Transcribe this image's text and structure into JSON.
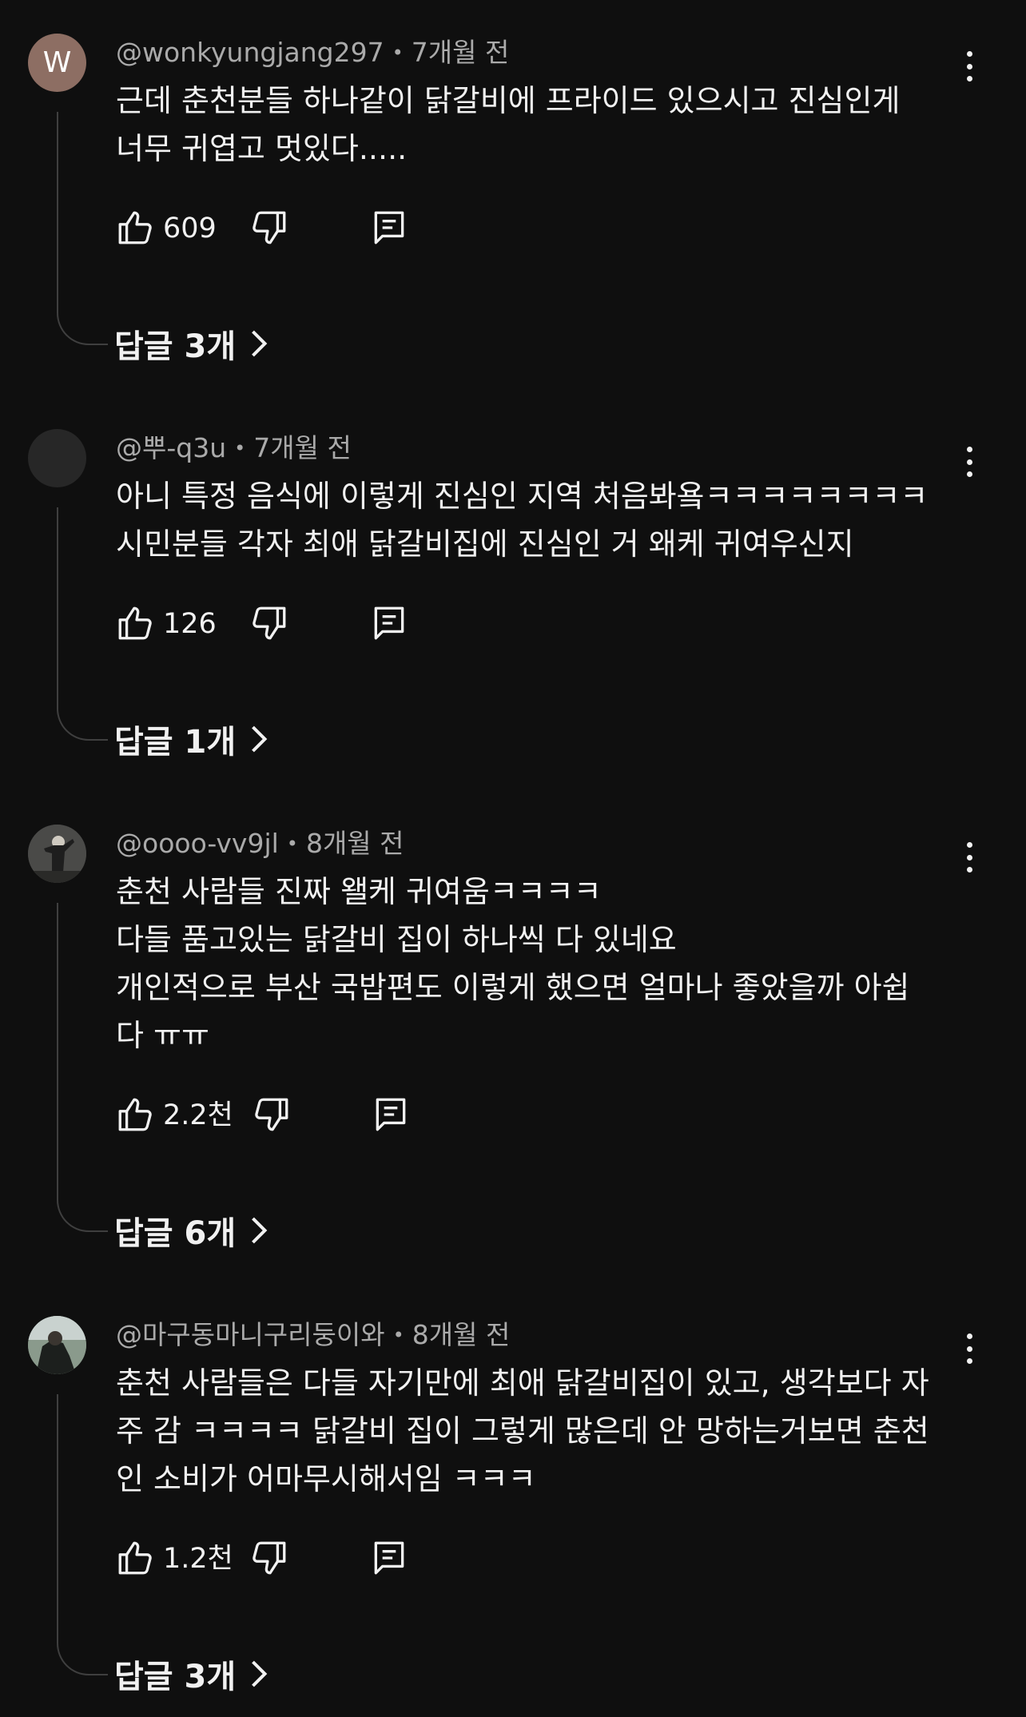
{
  "comments": [
    {
      "author": "@wonkyungjang297",
      "time": "7개월 전",
      "avatar_letter": "W",
      "avatar_color": "#8d6e63",
      "lines": [
        "근데 춘천분들 하나같이 닭갈비에 프라이드 있으시고 진심인게",
        "너무 귀엽고 멋있다....."
      ],
      "likes": "609",
      "replies_label": "답글 3개"
    },
    {
      "author": "@뿌-q3u",
      "time": "7개월 전",
      "avatar_letter": "",
      "avatar_color": "#272727",
      "lines": [
        "아니 특정 음식에 이렇게 진심인 지역 처음봐욬ㅋㅋㅋㅋㅋㅋㅋㅋ",
        "시민분들 각자 최애 닭갈비집에 진심인 거 왜케 귀여우신지"
      ],
      "likes": "126",
      "replies_label": "답글 1개"
    },
    {
      "author": "@oooo-vv9jl",
      "time": "8개월 전",
      "avatar_letter": "",
      "avatar_color": "#3a3a3a",
      "lines": [
        "춘천 사람들 진짜 왤케 귀여움ㅋㅋㅋㅋ",
        "다들 품고있는 닭갈비 집이 하나씩 다 있네요",
        "개인적으로 부산 국밥편도 이렇게 했으면 얼마나 좋았을까 아쉽",
        "다 ㅠㅠ"
      ],
      "likes": "2.2천",
      "replies_label": "답글 6개"
    },
    {
      "author": "@마구동마니구리둥이와",
      "time": "8개월 전",
      "avatar_letter": "",
      "avatar_color": "#5a6a5f",
      "lines": [
        "춘천 사람들은 다들 자기만에 최애 닭갈비집이 있고, 생각보다 자",
        "주 감 ㅋㅋㅋㅋ 닭갈비 집이 그렇게 많은데 안 망하는거보면 춘천",
        "인 소비가 어마무시해서임 ㅋㅋㅋ"
      ],
      "likes": "1.2천",
      "replies_label": "답글 3개"
    }
  ],
  "icons": {
    "like": "thumbs-up-icon",
    "dislike": "thumbs-down-icon",
    "reply": "comment-reply-icon",
    "more": "more-vertical-icon",
    "chevron": "chevron-right-icon"
  },
  "colors": {
    "background": "#0f0f0f",
    "text": "#f1f1f1",
    "meta": "#aaaaaa",
    "thread_line": "#3f3f3f"
  }
}
